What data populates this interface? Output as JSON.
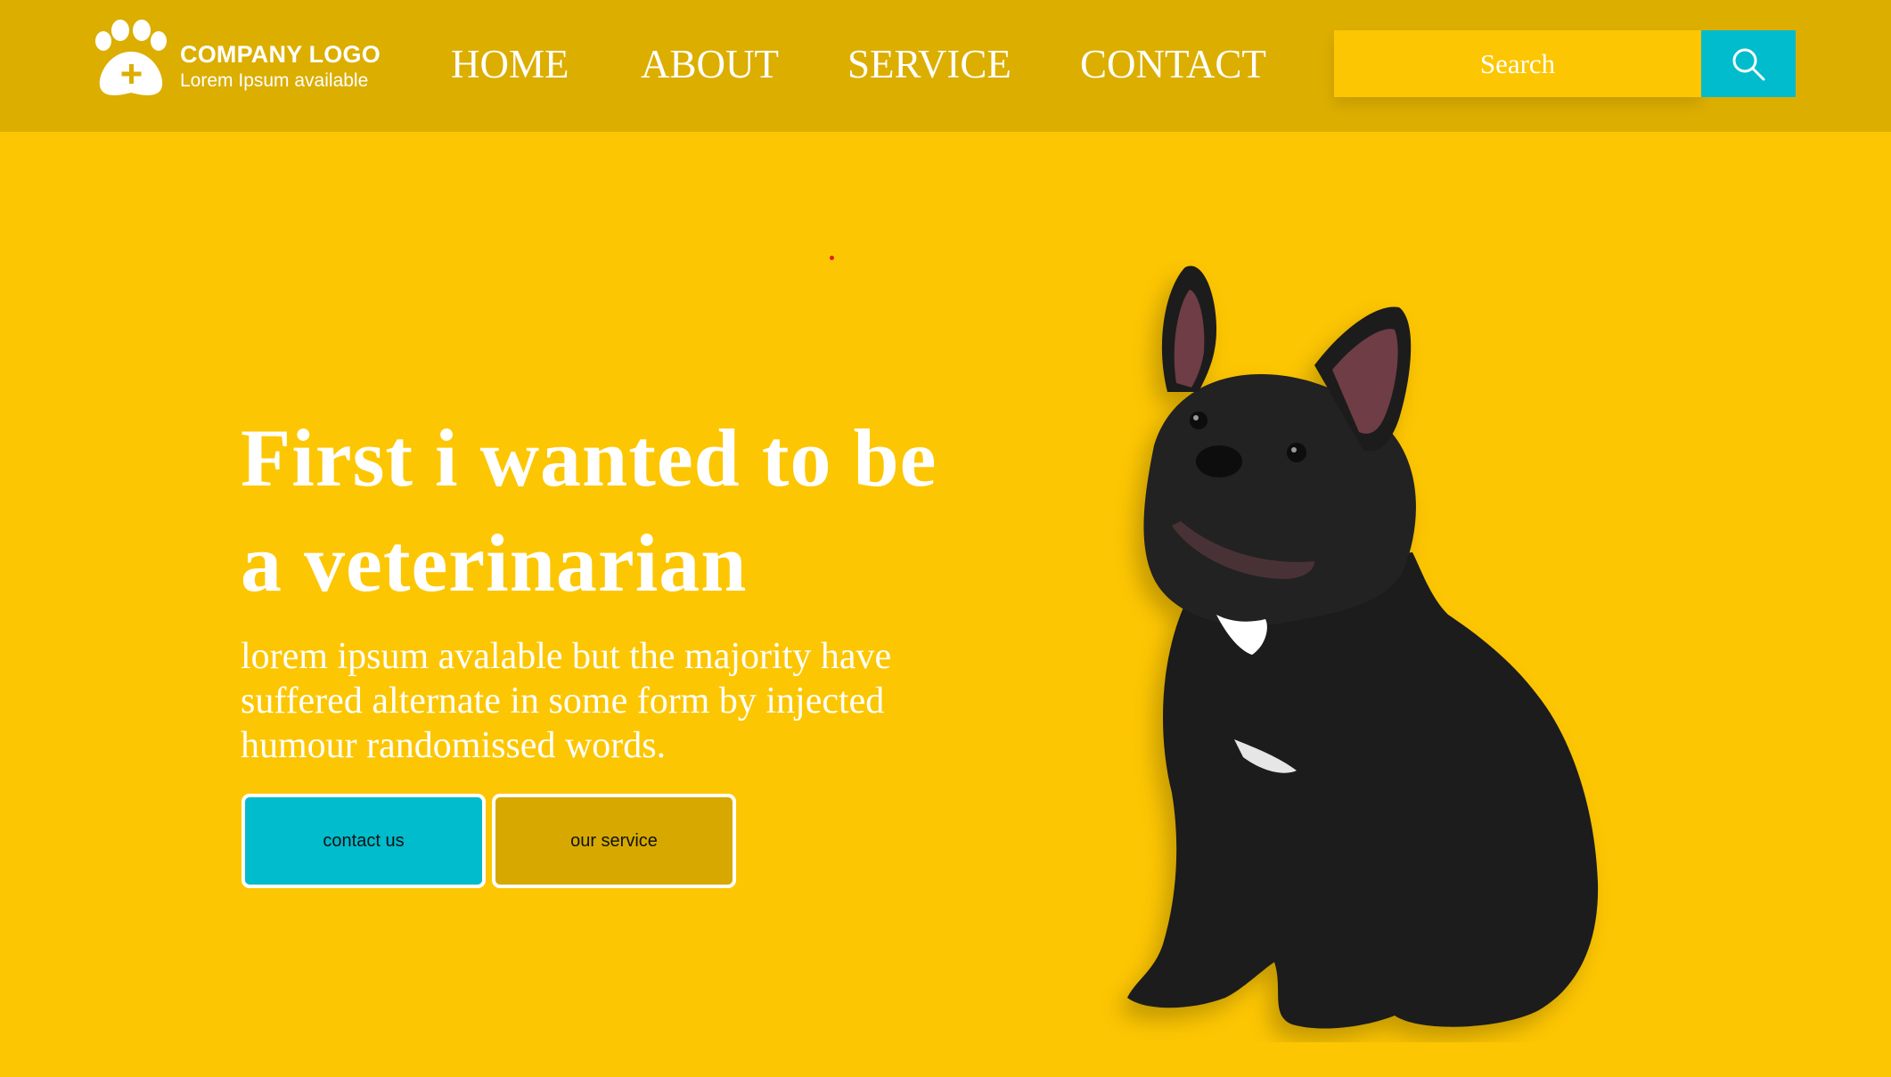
{
  "header": {
    "logo": {
      "title": "COMPANY LOGO",
      "subtitle": "Lorem Ipsum available",
      "icon": "paw-plus-icon"
    },
    "nav": [
      {
        "label": "HOME"
      },
      {
        "label": "ABOUT"
      },
      {
        "label": "SERVICE"
      },
      {
        "label": "CONTACT"
      }
    ],
    "search": {
      "placeholder": "Search",
      "value": "",
      "button_icon": "search-icon"
    }
  },
  "hero": {
    "title_line1": "First i wanted to be",
    "title_line2": "a veterinarian",
    "text_line1": "lorem ipsum avalable but the majority have",
    "text_line2": "suffered alternate in some form by injected",
    "text_line3": "humour randomissed words.",
    "buttons": {
      "contact": "contact us",
      "service": "our service"
    },
    "image_subject": "french-bulldog"
  },
  "colors": {
    "background": "#fdc602",
    "header": "#dcae00",
    "accent": "#00bccd",
    "secondary_button": "#d7a900",
    "text": "#ffffff"
  }
}
